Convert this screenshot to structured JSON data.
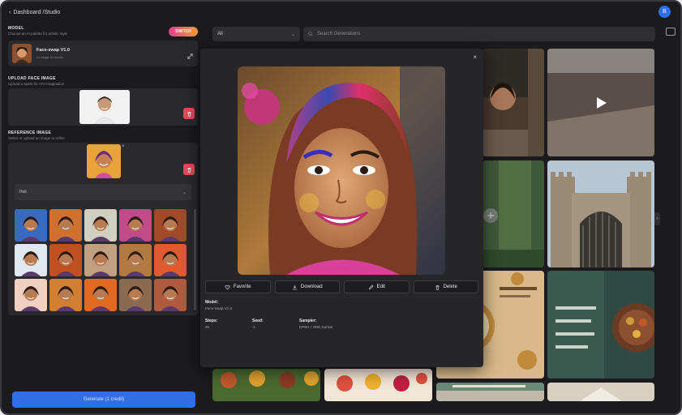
{
  "topbar": {
    "breadcrumb": "Dashboard /Studio",
    "back_icon": "chevron-left-icon",
    "avatar_initial": "B"
  },
  "sidebar": {
    "model": {
      "title": "MODEL",
      "subtitle": "Choose an AI palette for artistic style",
      "badge": "SWITCH",
      "name": "Face-swap V1.0",
      "sub": "AI image in results"
    },
    "upload": {
      "title": "UPLOAD FACE IMAGE",
      "subtitle": "Upload a spark for AI's imagination"
    },
    "reference": {
      "title": "REFERENCE IMAGE",
      "subtitle": "Select or upload an image to refine",
      "select_value": "Holi"
    },
    "generate_label": "Generate (1 credit)"
  },
  "main": {
    "filter_value": "All",
    "search_placeholder": "Search Generations"
  },
  "modal": {
    "close": "×",
    "actions": [
      {
        "label": "Favorite",
        "icon": "heart-icon"
      },
      {
        "label": "Download",
        "icon": "download-icon"
      },
      {
        "label": "Edit",
        "icon": "edit-icon"
      },
      {
        "label": "Delete",
        "icon": "trash-icon"
      }
    ],
    "model_label": "Model:",
    "model_value": "Face-swap V1.0",
    "steps_label": "Steps:",
    "steps_value": "25",
    "seed_label": "Seed:",
    "seed_value": "-1",
    "sampler_label": "Sampler:",
    "sampler_value": "DPM++ SDE Karras"
  },
  "colors": {
    "accent": "#2f6fe5",
    "danger": "#e24a5a",
    "badge_gradient_start": "#e2408f",
    "badge_gradient_end": "#f59a2c"
  }
}
